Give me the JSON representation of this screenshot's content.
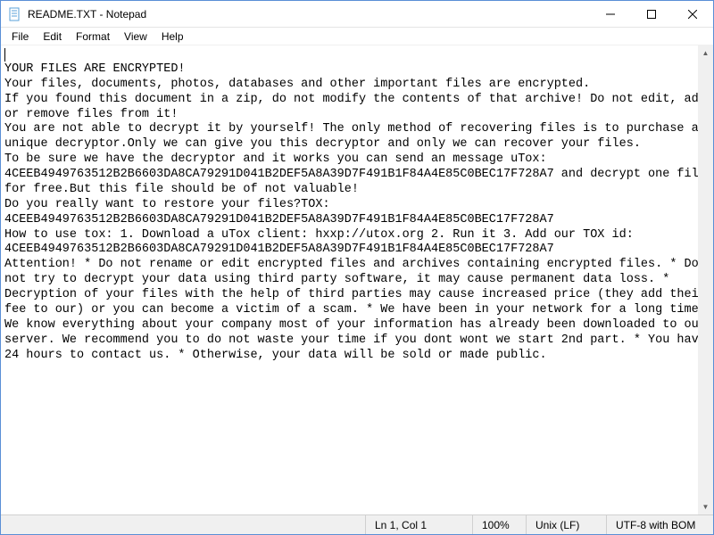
{
  "window": {
    "title": "README.TXT - Notepad"
  },
  "menu": {
    "file": "File",
    "edit": "Edit",
    "format": "Format",
    "view": "View",
    "help": "Help"
  },
  "content": {
    "body": "\nYOUR FILES ARE ENCRYPTED!\nYour files, documents, photos, databases and other important files are encrypted.\nIf you found this document in a zip, do not modify the contents of that archive! Do not edit, add or remove files from it!\nYou are not able to decrypt it by yourself! The only method of recovering files is to purchase an unique decryptor.Only we can give you this decryptor and only we can recover your files.\nTo be sure we have the decryptor and it works you can send an message uTox: 4CEEB4949763512B2B6603DA8CA79291D041B2DEF5A8A39D7F491B1F84A4E85C0BEC17F728A7 and decrypt one file for free.But this file should be of not valuable!\nDo you really want to restore your files?TOX: 4CEEB4949763512B2B6603DA8CA79291D041B2DEF5A8A39D7F491B1F84A4E85C0BEC17F728A7\nHow to use tox: 1. Download a uTox client: hxxp://utox.org 2. Run it 3. Add our TOX id: 4CEEB4949763512B2B6603DA8CA79291D041B2DEF5A8A39D7F491B1F84A4E85C0BEC17F728A7\nAttention! * Do not rename or edit encrypted files and archives containing encrypted files. * Do not try to decrypt your data using third party software, it may cause permanent data loss. * Decryption of your files with the help of third parties may cause increased price (they add their fee to our) or you can become a victim of a scam. * We have been in your network for a long time. We know everything about your company most of your information has already been downloaded to our server. We recommend you to do not waste your time if you dont wont we start 2nd part. * You have 24 hours to contact us. * Otherwise, your data will be sold or made public."
  },
  "status": {
    "position": "Ln 1, Col 1",
    "zoom": "100%",
    "lineending": "Unix (LF)",
    "encoding": "UTF-8 with BOM"
  }
}
